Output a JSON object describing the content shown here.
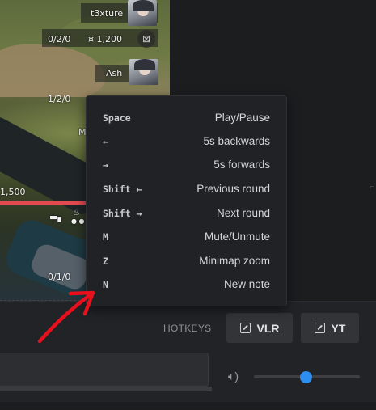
{
  "hud": {
    "players": [
      {
        "name": "t3xture",
        "kda": "0/2/0",
        "credits": "¤ 1,200"
      },
      {
        "name": "Ash",
        "kda": "1/2/0"
      }
    ],
    "partial_label": "M",
    "money_partial": "1,500",
    "kda_bottom": "0/1/0"
  },
  "hotkeys_popup": {
    "rows": [
      {
        "key": "Space",
        "action": "Play/Pause"
      },
      {
        "key": "←",
        "action": "5s backwards"
      },
      {
        "key": "→",
        "action": "5s forwards"
      },
      {
        "key": "Shift ←",
        "action": "Previous round"
      },
      {
        "key": "Shift →",
        "action": "Next round"
      },
      {
        "key": "M",
        "action": "Mute/Unmute"
      },
      {
        "key": "Z",
        "action": "Minimap zoom"
      },
      {
        "key": "N",
        "action": "New note"
      }
    ]
  },
  "controls": {
    "hotkeys_label": "HOTKEYS",
    "vlr_label": "VLR",
    "yt_label": "YT",
    "volume": 0.5
  },
  "colors": {
    "accent": "#2c8ef0",
    "annotation": "#e8101c",
    "health": "#e24a4f"
  }
}
